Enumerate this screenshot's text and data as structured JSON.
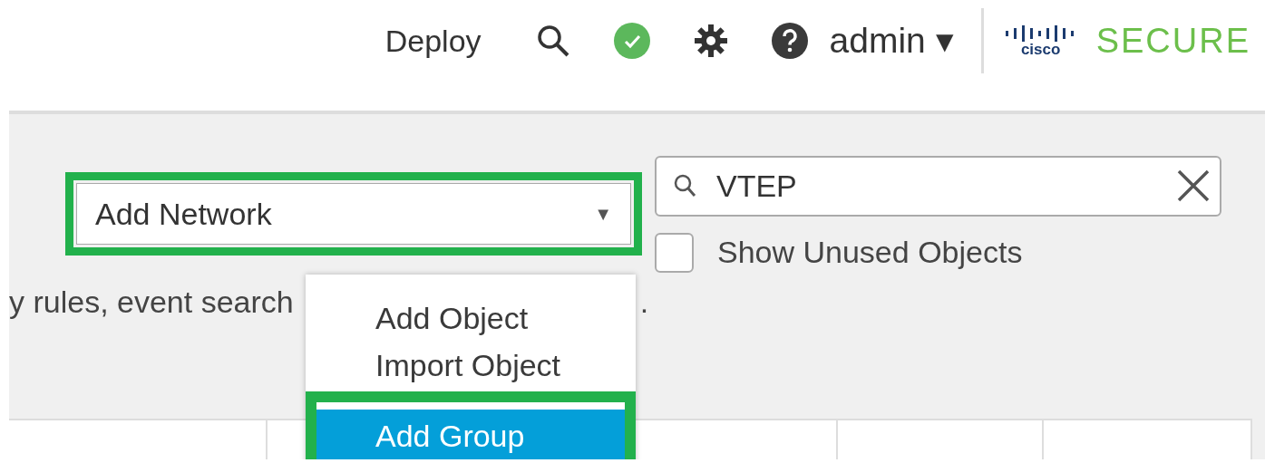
{
  "header": {
    "deploy": "Deploy",
    "status_ok": true,
    "user": "admin",
    "user_caret": "▾",
    "logo_text": "cisco",
    "brand": "SECURE"
  },
  "toolbar": {
    "add_dropdown": {
      "label": "Add Network",
      "caret": "▼",
      "highlighted": true
    },
    "search": {
      "value": "VTEP"
    },
    "show_unused": {
      "label": "Show Unused Objects",
      "checked": false
    }
  },
  "description": {
    "start": "y rules, event search",
    "end": "."
  },
  "dropdown_menu": {
    "items": [
      {
        "label": "Add Object",
        "selected": false,
        "highlighted": false
      },
      {
        "label": "Import Object",
        "selected": false,
        "highlighted": false
      },
      {
        "label": "Add Group",
        "selected": true,
        "highlighted": true
      }
    ]
  }
}
